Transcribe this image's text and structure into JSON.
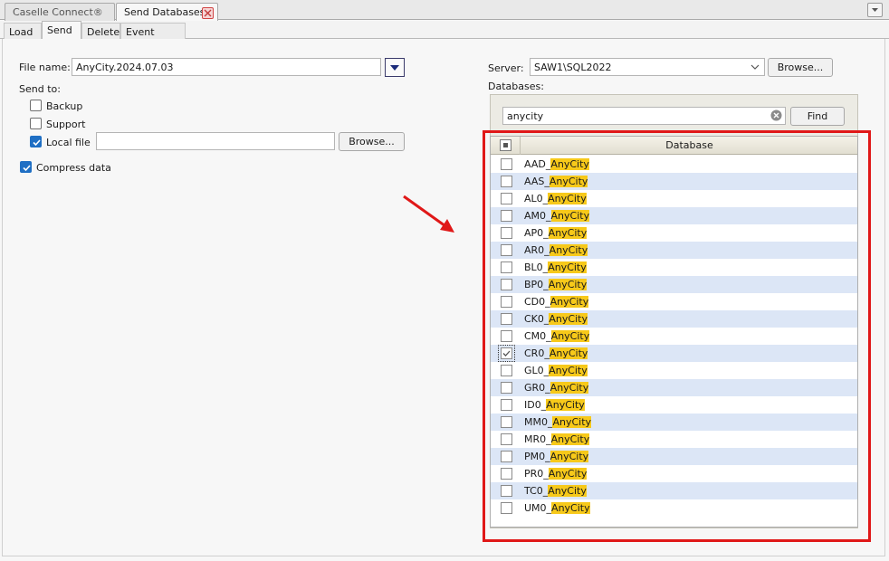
{
  "tabs": {
    "doc_tabs": [
      {
        "label": "Caselle Connect®"
      },
      {
        "label": "Send Databases"
      }
    ],
    "sub_tabs": [
      {
        "label": "Load"
      },
      {
        "label": "Send"
      },
      {
        "label": "Delete"
      },
      {
        "label": "Event Viewer"
      }
    ]
  },
  "left": {
    "file_name_label": "File name:",
    "file_name_value": "AnyCity.2024.07.03",
    "send_to_label": "Send to:",
    "backup_label": "Backup",
    "support_label": "Support",
    "local_file_label": "Local file",
    "local_file_value": "",
    "browse_label": "Browse...",
    "compress_label": "Compress data"
  },
  "right": {
    "server_label": "Server:",
    "server_value": "SAW1\\SQL2022",
    "browse_label": "Browse...",
    "databases_label": "Databases:",
    "search_value": "anycity",
    "find_label": "Find",
    "column_header": "Database"
  },
  "rows": [
    {
      "prefix": "AAD_",
      "match": "AnyCity",
      "checked": false
    },
    {
      "prefix": "AAS_",
      "match": "AnyCity",
      "checked": false
    },
    {
      "prefix": "AL0_",
      "match": "AnyCity",
      "checked": false
    },
    {
      "prefix": "AM0_",
      "match": "AnyCity",
      "checked": false
    },
    {
      "prefix": "AP0_",
      "match": "AnyCity",
      "checked": false
    },
    {
      "prefix": "AR0_",
      "match": "AnyCity",
      "checked": false
    },
    {
      "prefix": "BL0_",
      "match": "AnyCity",
      "checked": false
    },
    {
      "prefix": "BP0_",
      "match": "AnyCity",
      "checked": false
    },
    {
      "prefix": "CD0_",
      "match": "AnyCity",
      "checked": false
    },
    {
      "prefix": "CK0_",
      "match": "AnyCity",
      "checked": false
    },
    {
      "prefix": "CM0_",
      "match": "AnyCity",
      "checked": false
    },
    {
      "prefix": "CR0_",
      "match": "AnyCity",
      "checked": true
    },
    {
      "prefix": "GL0_",
      "match": "AnyCity",
      "checked": false
    },
    {
      "prefix": "GR0_",
      "match": "AnyCity",
      "checked": false
    },
    {
      "prefix": "ID0_",
      "match": "AnyCity",
      "checked": false
    },
    {
      "prefix": "MM0_",
      "match": "AnyCity",
      "checked": false
    },
    {
      "prefix": "MR0_",
      "match": "AnyCity",
      "checked": false
    },
    {
      "prefix": "PM0_",
      "match": "AnyCity",
      "checked": false
    },
    {
      "prefix": "PR0_",
      "match": "AnyCity",
      "checked": false
    },
    {
      "prefix": "TC0_",
      "match": "AnyCity",
      "checked": false
    },
    {
      "prefix": "UM0_",
      "match": "AnyCity",
      "checked": false
    }
  ],
  "colors": {
    "highlight": "#f7c91a",
    "alt_row": "#dce6f6",
    "annotation": "#e01818",
    "checkbox_on": "#1f6fc4"
  },
  "icons": {
    "close_tab": "close-icon",
    "tab_dropdown": "chevron-down-icon",
    "file_dropdown": "triangle-down-icon",
    "clear_search": "clear-icon",
    "annotation_arrow": "arrow-icon"
  }
}
